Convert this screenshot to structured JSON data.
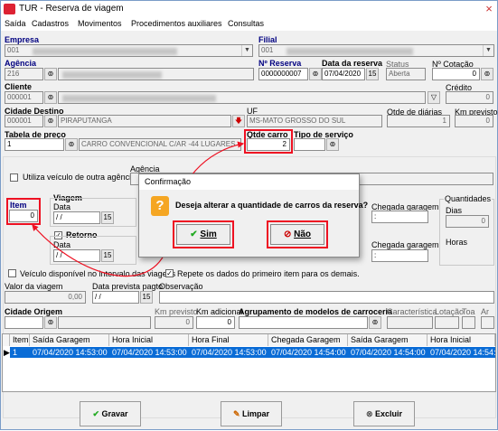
{
  "window": {
    "title": "TUR - Reserva de viagem",
    "close_icon": "×"
  },
  "menu": [
    "Saída",
    "Cadastros",
    "Movimentos",
    "Procedimentos auxiliares",
    "Consultas"
  ],
  "form": {
    "empresa_label": "Empresa",
    "empresa_code": "001",
    "filial_label": "Filial",
    "filial_code": "001",
    "agencia_label": "Agência",
    "agencia_code": "216",
    "nreserva_label": "Nº Reserva",
    "nreserva_value": "0000000007",
    "data_reserva_label": "Data da reserva",
    "data_reserva_value": "07/04/2020",
    "status_label": "Status",
    "status_value": "Aberta",
    "ncotacao_label": "Nº Cotação",
    "ncotacao_value": "0",
    "cliente_label": "Cliente",
    "cliente_code": "000001",
    "credito_label": "Crédito",
    "credito_value": "0",
    "cidade_destino_label": "Cidade Destino",
    "cidade_destino_code": "000001",
    "cidade_destino_name": "PIRAPUTANGA",
    "uf_label": "UF",
    "uf_value": "MS-MATO GROSSO DO SUL",
    "qtde_diarias_label": "Qtde de diárias",
    "qtde_diarias_value": "1",
    "km_previsto_label": "Km previsto",
    "km_previsto_value": "0",
    "tabela_preco_label": "Tabela de preço",
    "tabela_preco_code": "1",
    "tabela_preco_name": "CARRO CONVENCIONAL C/AR -44 LUGARES",
    "qtde_carro_label": "Qtde carro",
    "qtde_carro_value": "2",
    "tipo_servico_label": "Tipo de serviço",
    "utiliza_label": "Utiliza veículo de outra agência",
    "agencia2_label": "Agência",
    "item_label": "Item",
    "item_value": "0",
    "viagem_label": "Viagem",
    "data_label": "Data",
    "data_empty": "/ /",
    "retorno_label": "Retorno",
    "data2_label": "Data",
    "chegada_garagem_label": "Chegada garagem",
    "chegada_garagem_value": ":",
    "chegada_garagem2_label": "Chegada garagem",
    "chegada_garagem2_value": ":",
    "quantidades_label": "Quantidades",
    "dias_label": "Dias",
    "dias_value": "0",
    "horas_label": "Horas",
    "veiculo_disp_label": "Veículo disponível no intervalo das viagens",
    "repete_label": "Repete os dados do primeiro item para os demais.",
    "valor_viagem_label": "Valor da viagem",
    "valor_viagem_value": "0,00",
    "data_prev_pagto_label": "Data prevista pagto",
    "data_prev_pagto_value": "/ /",
    "observacao_label": "Observação",
    "cidade_origem_label": "Cidade Origem",
    "km_previsto2_label": "Km previsto",
    "km_previsto2_value": "0",
    "km_adicional_label": "Km adicional",
    "km_adicional_value": "0",
    "agrupamento_label": "Agrupamento de modelos de carroceria",
    "caracteristica_label": "Característica",
    "lotacao_label": "Lotação",
    "toa_label": "Toa",
    "ar_label": "Ar"
  },
  "grid": {
    "headers": [
      "Item",
      "Saída Garagem",
      "Hora Inicial",
      "Hora Final",
      "Chegada Garagem",
      "Saída Garagem",
      "Hora Inicial"
    ],
    "row": [
      "1",
      "07/04/2020 14:53:00",
      "07/04/2020 14:53:00",
      "07/04/2020 14:53:00",
      "07/04/2020 14:54:00",
      "07/04/2020 14:54:00",
      "07/04/2020 14:54:00"
    ]
  },
  "buttons": {
    "gravar": "Gravar",
    "limpar": "Limpar",
    "excluir": "Excluir"
  },
  "dialog": {
    "title": "Confirmação",
    "message": "Deseja alterar a quantidade de carros da reserva?",
    "yes": "Sim",
    "no": "Não",
    "icon": "?"
  },
  "colors": {
    "highlight": "#e01020",
    "selection": "#0a6cd6",
    "label_blue": "#000080"
  }
}
